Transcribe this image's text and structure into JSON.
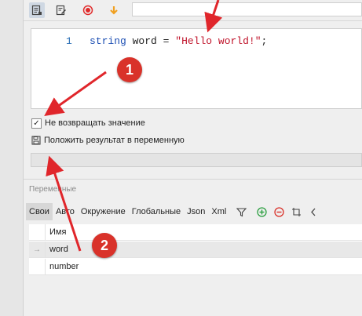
{
  "code": {
    "line_number": "1",
    "keyword": "string",
    "variable": "word",
    "operator": "=",
    "string_literal": "\"Hello world!\"",
    "terminator": ";"
  },
  "options": {
    "checkbox_label": "Не возвращать значение",
    "checkbox_checked": true,
    "save_label": "Положить результат в переменную"
  },
  "variables_panel": {
    "title": "Переменные",
    "tabs": [
      "Свои",
      "Авто",
      "Окружение",
      "Глобальные",
      "Json",
      "Xml"
    ],
    "selected_tab": "Свои",
    "column_header": "Имя",
    "rows": [
      "word",
      "number"
    ]
  },
  "annotations": [
    "1",
    "2"
  ],
  "colors": {
    "keyword": "#1d4fb3",
    "string": "#c0142b",
    "badge": "#d9322a",
    "arrow": "#e0262b",
    "selected_tab": "#d7d7d7"
  }
}
